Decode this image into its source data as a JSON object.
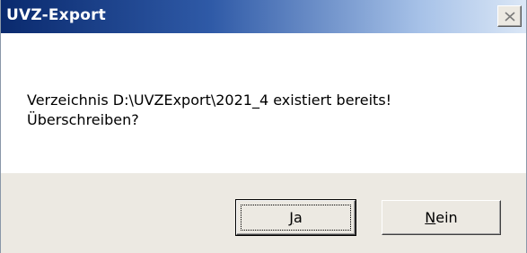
{
  "window": {
    "title": "UVZ-Export"
  },
  "message": {
    "line1": "Verzeichnis D:\\UVZExport\\2021_4 existiert bereits!",
    "line2": "Überschreiben?"
  },
  "buttons": {
    "yes": {
      "mnemonic": "J",
      "rest": "a"
    },
    "no": {
      "mnemonic": "N",
      "rest": "ein"
    }
  },
  "icons": {
    "close": "close-icon"
  }
}
